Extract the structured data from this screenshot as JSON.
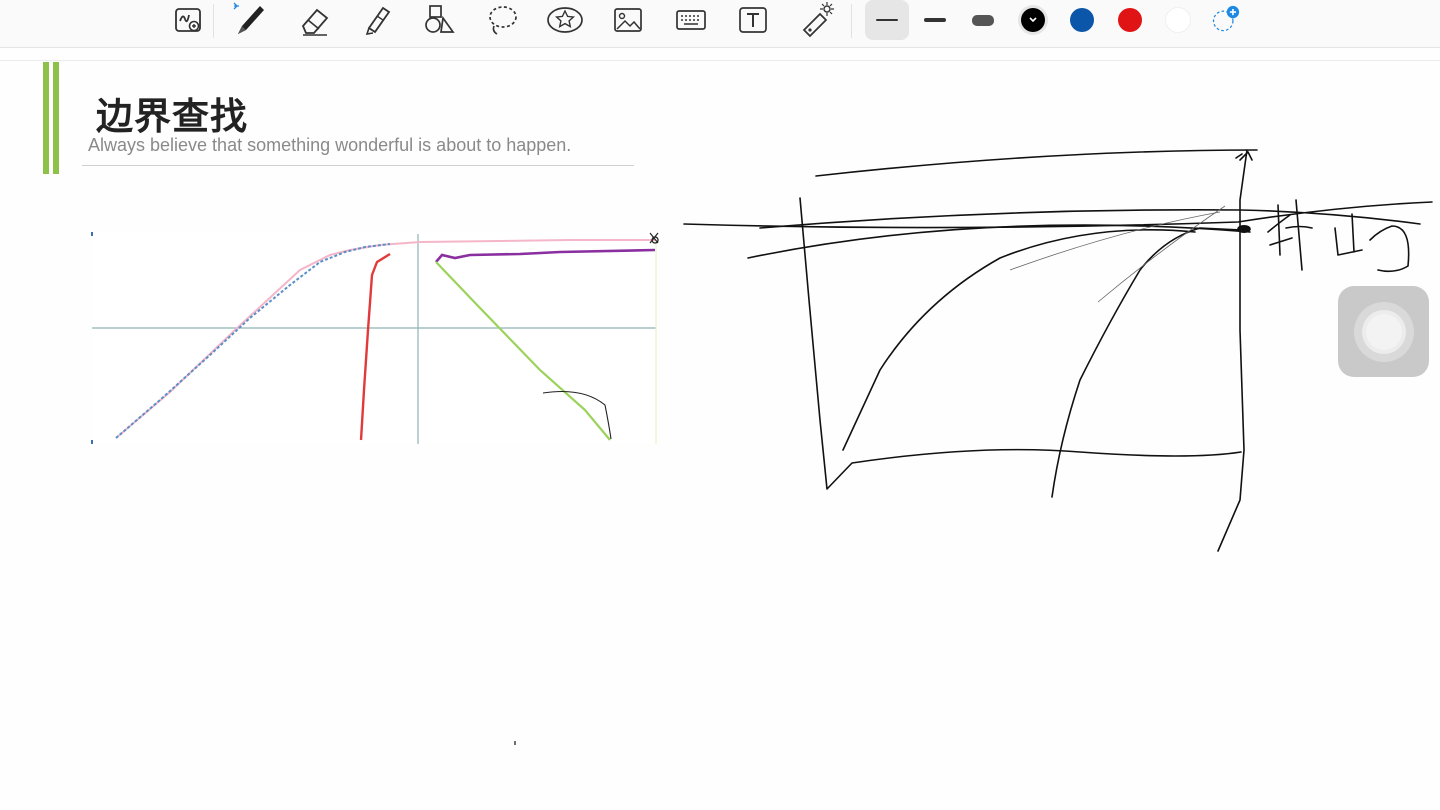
{
  "toolbar": {
    "tools": [
      {
        "name": "zoom-write-icon"
      },
      {
        "name": "pen-icon",
        "badge": "bluetooth-icon"
      },
      {
        "name": "eraser-icon"
      },
      {
        "name": "highlighter-icon"
      },
      {
        "name": "shapes-icon"
      },
      {
        "name": "lasso-icon"
      },
      {
        "name": "sticker-icon"
      },
      {
        "name": "image-icon"
      },
      {
        "name": "keyboard-icon"
      },
      {
        "name": "text-box-icon"
      },
      {
        "name": "laser-pointer-icon"
      }
    ],
    "stroke_widths": [
      "thin",
      "medium",
      "thick"
    ],
    "selected_stroke": "thin",
    "colors": [
      "#000000",
      "#0b56a8",
      "#e01414",
      "#ffffff"
    ],
    "selected_color": "#000000",
    "add_color_icon": "add-color-icon"
  },
  "slide": {
    "title": "边界查找",
    "subtitle": "Always believe that something wonderful is about to happen.",
    "accent_color": "#8dc149"
  },
  "floating_button": {
    "icon": "assistive-touch-icon"
  }
}
